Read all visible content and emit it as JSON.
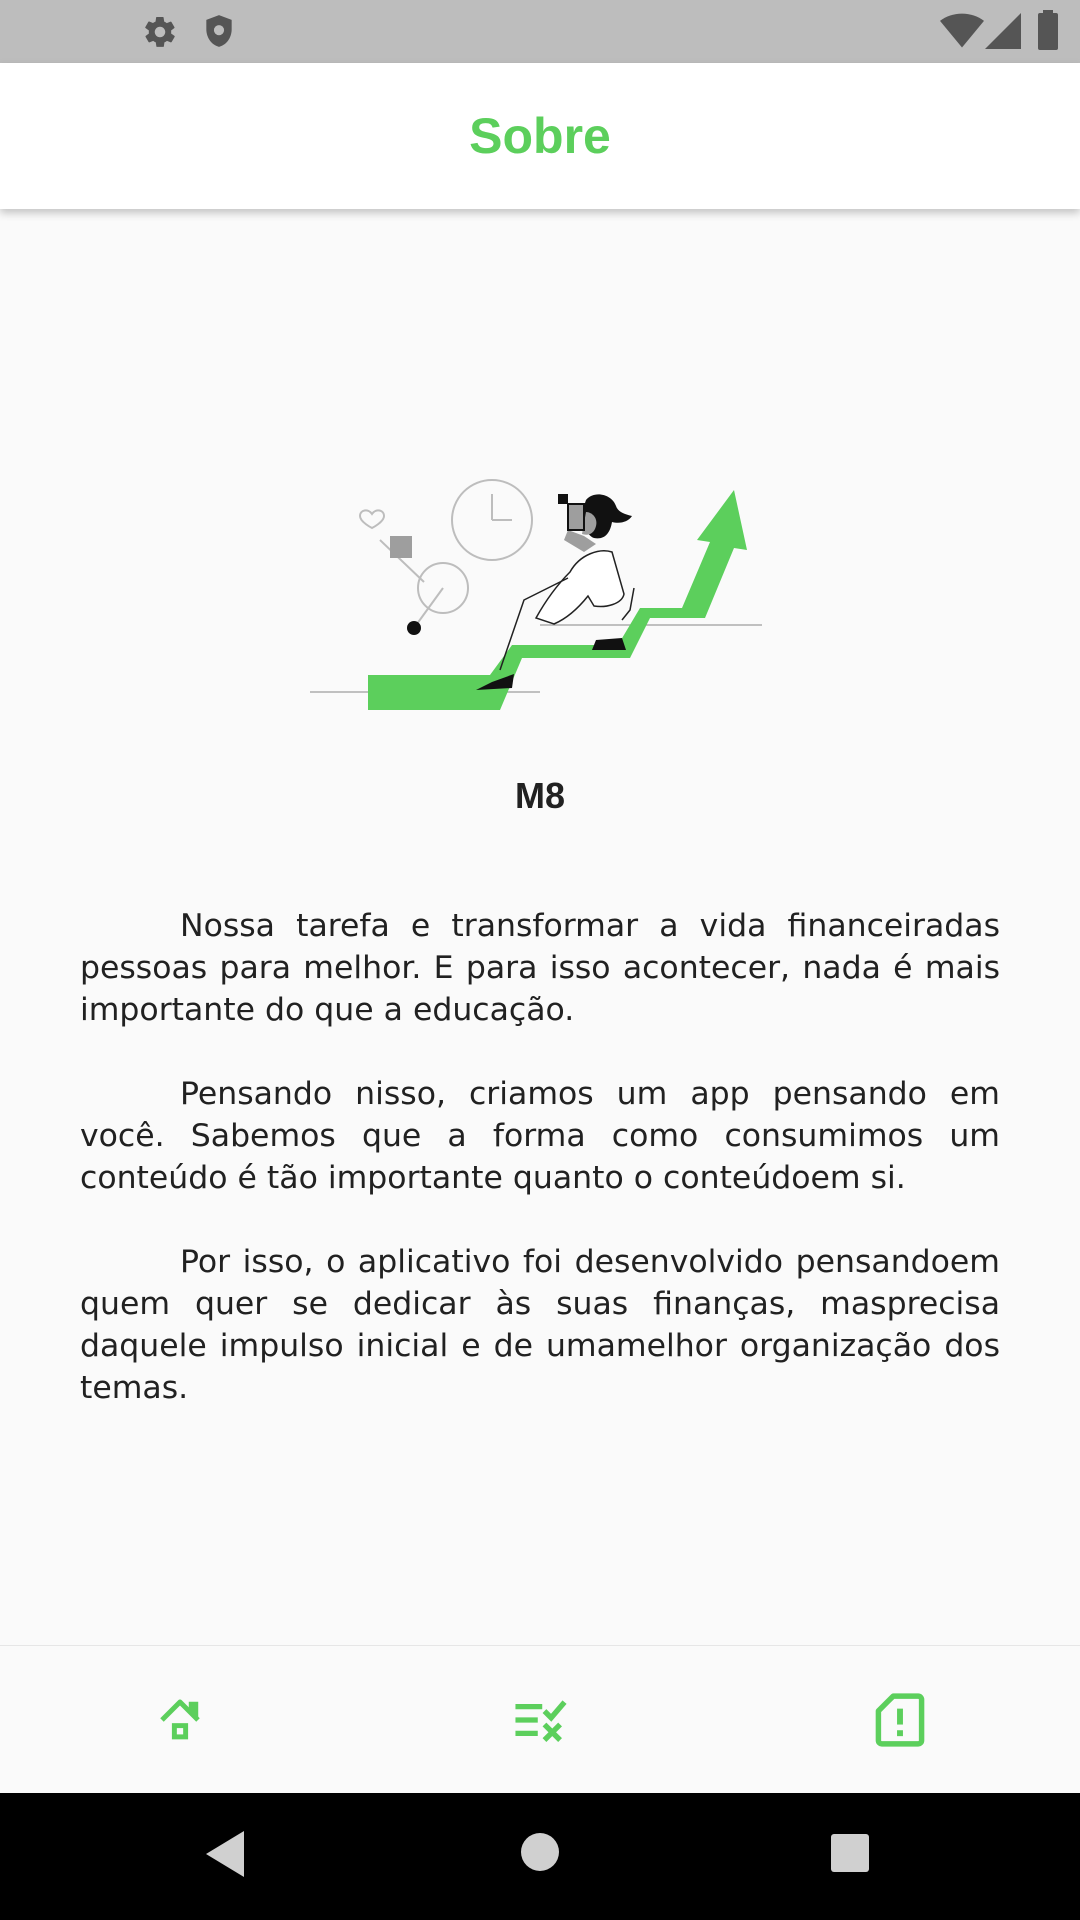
{
  "colors": {
    "accent": "#5ccf5c",
    "status_bar": "#bdbdbd",
    "background": "#fafafa",
    "text": "#212121",
    "system_nav": "#000000"
  },
  "status_bar": {
    "left_icons": [
      "gear-icon",
      "shield-icon"
    ],
    "right_icons": [
      "wifi-icon",
      "cell-signal-icon",
      "battery-icon"
    ]
  },
  "app_bar": {
    "title": "Sobre"
  },
  "hero": {
    "illustration": "woman-climbing-growth-arrow-illustration"
  },
  "app_name": "M8",
  "about_paragraphs": [
    "Nossa tarefa e transformar a vida financeiradas pessoas para melhor. E para isso acontecer, nada é mais importante do que a educação.",
    "Pensando nisso, criamos um app pensando em você. Sabemos que a forma como consumimos um conteúdo é tão importante quanto o conteúdoem si.",
    "Por isso, o aplicativo foi desenvolvido pensandoem quem quer se dedicar às suas finanças, masprecisa daquele impulso inicial e de umamelhor organização dos temas."
  ],
  "bottom_nav": [
    {
      "icon": "home-icon"
    },
    {
      "icon": "checklist-icon"
    },
    {
      "icon": "report-icon"
    }
  ],
  "system_nav": [
    "back-icon",
    "home-circle-icon",
    "recents-icon"
  ]
}
